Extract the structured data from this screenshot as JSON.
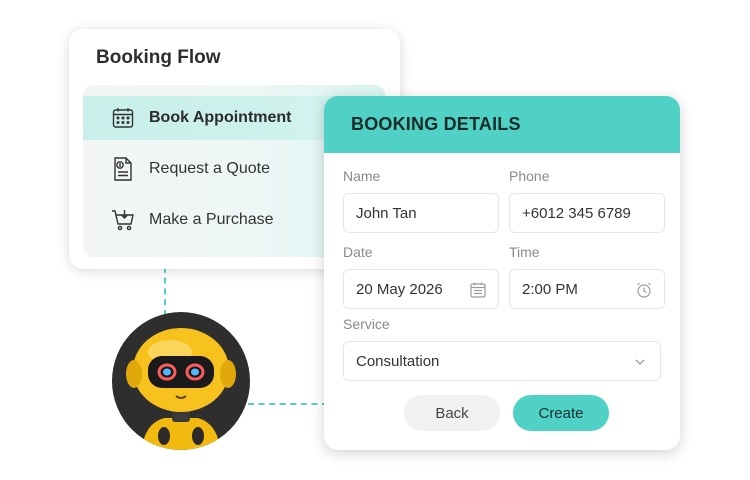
{
  "flow": {
    "title": "Booking Flow",
    "items": [
      {
        "label": "Book Appointment",
        "icon": "calendar-icon",
        "active": true
      },
      {
        "label": "Request a Quote",
        "icon": "invoice-icon",
        "active": false
      },
      {
        "label": "Make a Purchase",
        "icon": "cart-icon",
        "active": false
      }
    ]
  },
  "details": {
    "title": "BOOKING DETAILS",
    "name": {
      "label": "Name",
      "value": "John Tan"
    },
    "phone": {
      "label": "Phone",
      "value": "+6012 345 6789"
    },
    "date": {
      "label": "Date",
      "value": "20 May 2026"
    },
    "time": {
      "label": "Time",
      "value": "2:00 PM"
    },
    "service": {
      "label": "Service",
      "value": "Consultation"
    },
    "back_label": "Back",
    "create_label": "Create"
  },
  "colors": {
    "accent": "#4fd1c5",
    "active_row": "#c9f0eb",
    "robot_yellow": "#f7c21e"
  }
}
